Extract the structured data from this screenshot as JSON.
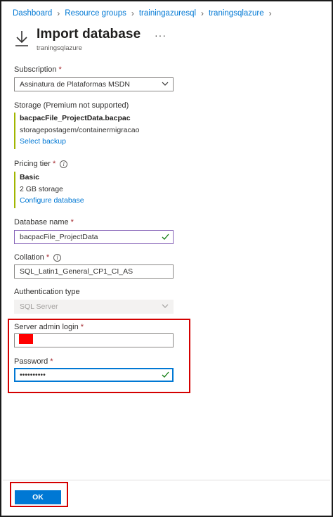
{
  "breadcrumb": [
    {
      "label": "Dashboard"
    },
    {
      "label": "Resource groups"
    },
    {
      "label": "trainingazuresql"
    },
    {
      "label": "traningsqlazure"
    }
  ],
  "header": {
    "title": "Import database",
    "subtitle": "traningsqlazure",
    "more": "···"
  },
  "subscription": {
    "label": "Subscription",
    "required": "*",
    "value": "Assinatura de Plataformas MSDN"
  },
  "storage": {
    "label": "Storage (Premium not supported)",
    "file": "bacpacFile_ProjectData.bacpac",
    "path": "storagepostagem/containermigracao",
    "link": "Select backup"
  },
  "pricing": {
    "label": "Pricing tier",
    "required": "*",
    "tier": "Basic",
    "storage": "2 GB storage",
    "link": "Configure database"
  },
  "database_name": {
    "label": "Database name",
    "required": "*",
    "value": "bacpacFile_ProjectData"
  },
  "collation": {
    "label": "Collation",
    "required": "*",
    "value": "SQL_Latin1_General_CP1_CI_AS"
  },
  "auth": {
    "label": "Authentication type",
    "value": "SQL Server"
  },
  "admin_login": {
    "label": "Server admin login",
    "required": "*",
    "value": ""
  },
  "password": {
    "label": "Password",
    "required": "*",
    "value": "••••••••••"
  },
  "footer": {
    "ok_label": "OK"
  },
  "colors": {
    "accent": "#0078d4",
    "highlight": "#d40000",
    "valid": "#107c10",
    "summary_bar": "#a1b600"
  }
}
